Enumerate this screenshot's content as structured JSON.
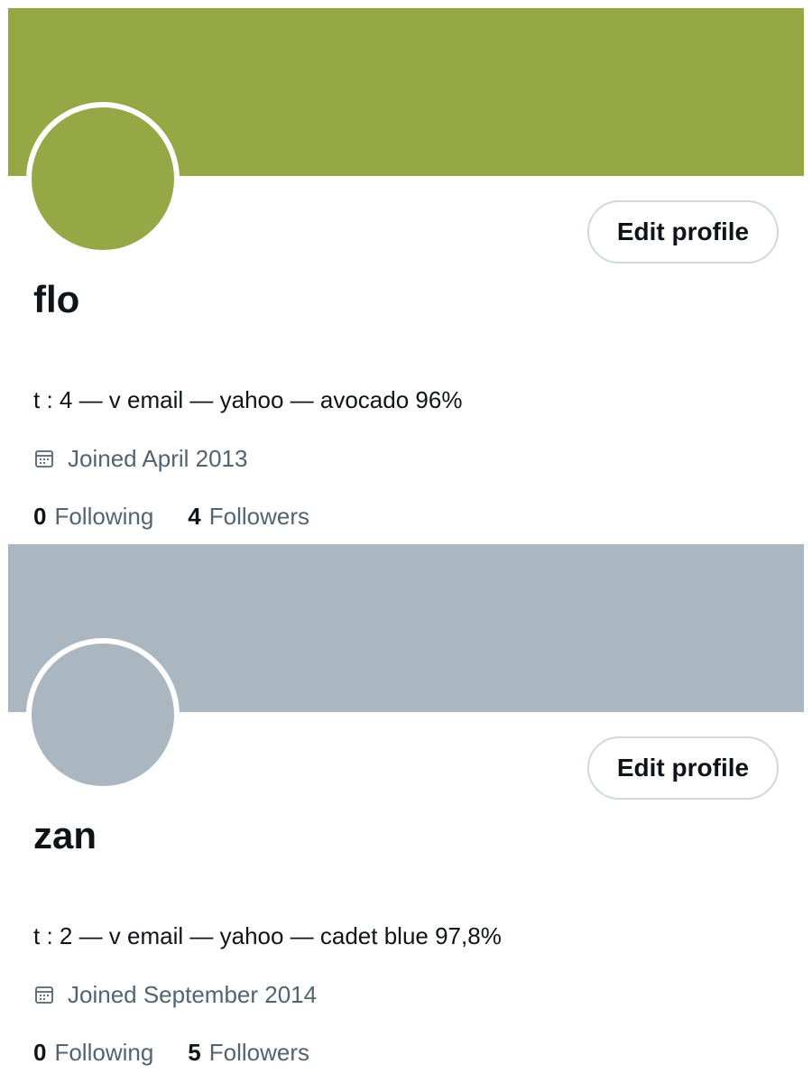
{
  "profiles": [
    {
      "accent_color": "#95a845",
      "display_name": "flo",
      "edit_button_label": "Edit profile",
      "bio": "t : 4 — v email — yahoo — avocado 96%",
      "joined_text": "Joined April 2013",
      "joined_icon": "calendar-icon",
      "following_count": "0",
      "following_label": "Following",
      "followers_count": "4",
      "followers_label": "Followers"
    },
    {
      "accent_color": "#aab7c1",
      "display_name": "zan",
      "edit_button_label": "Edit profile",
      "bio": "t : 2 — v email — yahoo — cadet blue 97,8%",
      "joined_text": "Joined September 2014",
      "joined_icon": "calendar-icon",
      "following_count": "0",
      "following_label": "Following",
      "followers_count": "5",
      "followers_label": "Followers"
    }
  ]
}
